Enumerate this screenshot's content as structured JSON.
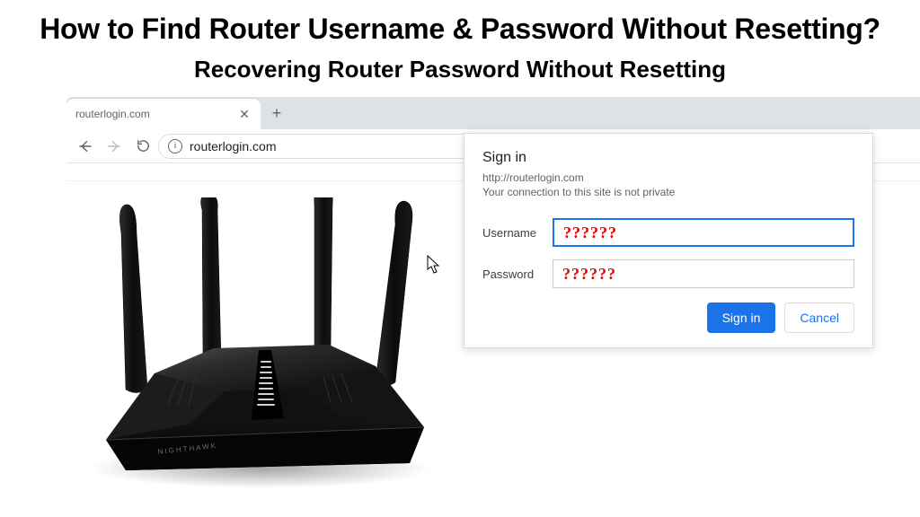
{
  "headings": {
    "title": "How to Find Router Username & Password Without Resetting?",
    "subtitle": "Recovering Router Password Without Resetting"
  },
  "browser": {
    "tab_title": "routerlogin.com",
    "address": "routerlogin.com"
  },
  "dialog": {
    "title": "Sign in",
    "url": "http://routerlogin.com",
    "note": "Your connection to this site is not private",
    "username_label": "Username",
    "password_label": "Password",
    "username_value": "??????",
    "password_value": "??????",
    "signin_label": "Sign in",
    "cancel_label": "Cancel"
  },
  "router_brand": "NIGHTHAWK"
}
